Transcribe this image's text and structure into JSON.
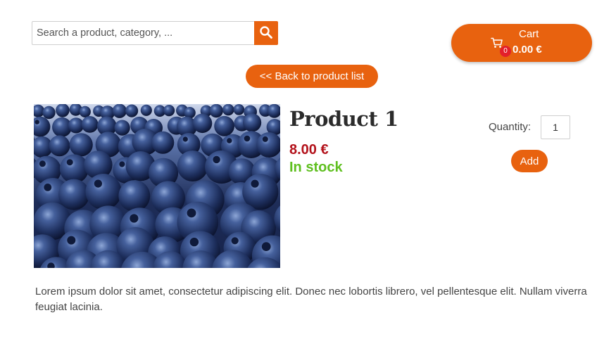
{
  "search": {
    "placeholder": "Search a product, category, ...",
    "icon": "search-icon"
  },
  "cart": {
    "label": "Cart",
    "item_count": "0",
    "total": "0.00 €",
    "icon": "cart-icon"
  },
  "navigation": {
    "back_label": "<< Back to product list"
  },
  "product": {
    "title": "Product 1",
    "price": "8.00 €",
    "stock_status": "In stock",
    "image": "blueberries-photo",
    "quantity_label": "Quantity:",
    "quantity_value": "1",
    "add_label": "Add",
    "description": "Lorem ipsum dolor sit amet, consectetur adipiscing elit. Donec nec lobortis librero, vel pellentesque elit. Nullam viverra feugiat lacinia."
  },
  "colors": {
    "accent": "#e8620f",
    "price": "#b3121b",
    "in_stock": "#5fbf1f",
    "badge": "#e3202a"
  }
}
